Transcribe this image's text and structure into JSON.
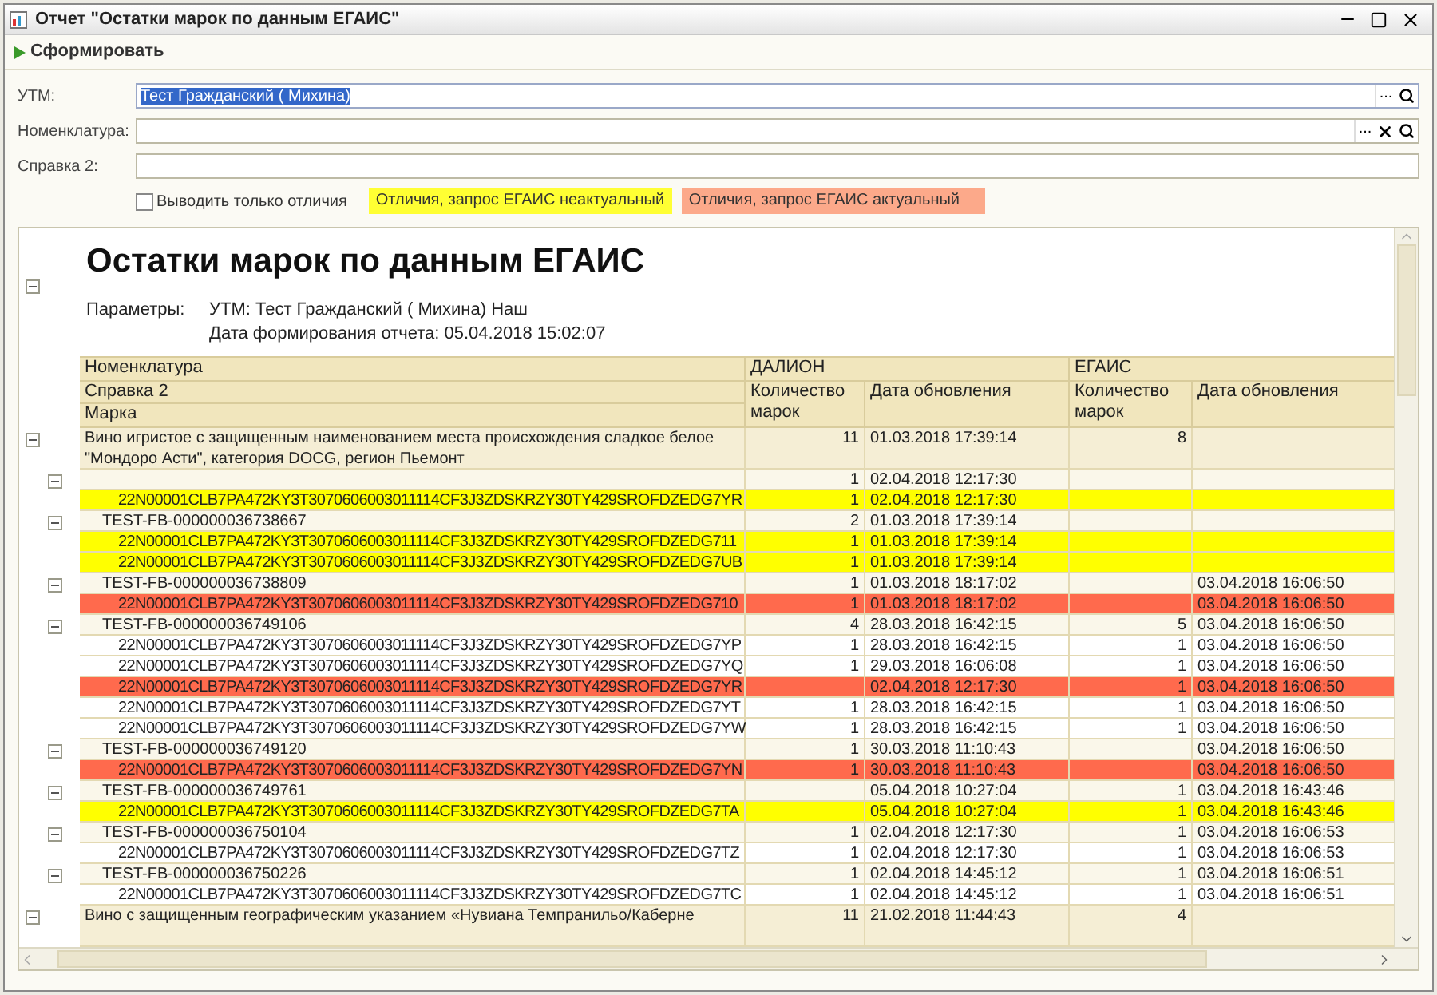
{
  "window": {
    "title": "Отчет \"Остатки марок по данным ЕГАИС\""
  },
  "toolbar": {
    "generate_button": "Сформировать"
  },
  "form": {
    "fields": [
      {
        "label": "УТМ:",
        "value": "Тест Гражданский ( Михина)",
        "selected": true,
        "clear": false,
        "buttons": true
      },
      {
        "label": "Номенклатура:",
        "selected": false,
        "clear": true,
        "buttons": true
      },
      {
        "label": "Справка 2:",
        "selected": false,
        "clear": false,
        "buttons": false
      }
    ],
    "select_button": "...",
    "only_diff": {
      "label": "Выводить только отличия",
      "checked": false
    },
    "legend": [
      {
        "label": "Отличия, запрос ЕГАИС неактуальный",
        "color": "#ffff33"
      },
      {
        "label": "Отличия, запрос ЕГАИС актуальный",
        "color": "#fca98a"
      }
    ]
  },
  "report": {
    "title": "Остатки марок по данным ЕГАИС",
    "expanded": true,
    "params_label": "Параметры:",
    "params": [
      "УТМ: Тест Гражданский ( Михина) Наш",
      "Дата формирования отчета: 05.04.2018 15:02:07"
    ],
    "header": {
      "name_rows": [
        "Номенклатура",
        "Справка 2",
        "Марка"
      ],
      "groups": [
        {
          "label": "ДАЛИОН",
          "qty": "Количество марок",
          "date": "Дата обновления"
        },
        {
          "label": "ЕГАИС",
          "qty": "Количество марок",
          "date": "Дата обновления"
        }
      ]
    },
    "products": [
      {
        "name": "Вино игристое с защищенным наименованием места происхождения сладкое белое \"Мондоро Асти\", категория DOCG, регион Пьемонт",
        "qty1": "11",
        "date1": "01.03.2018 17:39:14",
        "qty2": "8",
        "expanded": true,
        "children": [
          {
            "qty1": "1",
            "date1": "02.04.2018 12:17:30",
            "expanded": true,
            "children": [
              {
                "name": "22N00001CLB7PA472KY3T3070606003011114CF3J3ZDSKRZY30TY429SROFDZEDG7YR",
                "color": "#ffff00",
                "qty1": "1",
                "date1": "02.04.2018 12:17:30"
              }
            ]
          },
          {
            "name": "TEST-FB-000000036738667",
            "qty1": "2",
            "date1": "01.03.2018 17:39:14",
            "expanded": true,
            "children": [
              {
                "name": "22N00001CLB7PA472KY3T3070606003011114CF3J3ZDSKRZY30TY429SROFDZEDG711",
                "color": "#ffff00",
                "qty1": "1",
                "date1": "01.03.2018 17:39:14"
              },
              {
                "name": "22N00001CLB7PA472KY3T3070606003011114CF3J3ZDSKRZY30TY429SROFDZEDG7UB",
                "color": "#ffff00",
                "qty1": "1",
                "date1": "01.03.2018 17:39:14"
              }
            ]
          },
          {
            "name": "TEST-FB-000000036738809",
            "qty1": "1",
            "date1": "01.03.2018 18:17:02",
            "date2": "03.04.2018 16:06:50",
            "expanded": true,
            "children": [
              {
                "name": "22N00001CLB7PA472KY3T3070606003011114CF3J3ZDSKRZY30TY429SROFDZEDG710",
                "color": "#ff6a4d",
                "qty1": "1",
                "date1": "01.03.2018 18:17:02",
                "date2": "03.04.2018 16:06:50"
              }
            ]
          },
          {
            "name": "TEST-FB-000000036749106",
            "qty1": "4",
            "date1": "28.03.2018 16:42:15",
            "qty2": "5",
            "date2": "03.04.2018 16:06:50",
            "expanded": true,
            "children": [
              {
                "name": "22N00001CLB7PA472KY3T3070606003011114CF3J3ZDSKRZY30TY429SROFDZEDG7YP",
                "qty1": "1",
                "date1": "28.03.2018 16:42:15",
                "qty2": "1",
                "date2": "03.04.2018 16:06:50"
              },
              {
                "name": "22N00001CLB7PA472KY3T3070606003011114CF3J3ZDSKRZY30TY429SROFDZEDG7YQ",
                "qty1": "1",
                "date1": "29.03.2018 16:06:08",
                "qty2": "1",
                "date2": "03.04.2018 16:06:50"
              },
              {
                "name": "22N00001CLB7PA472KY3T3070606003011114CF3J3ZDSKRZY30TY429SROFDZEDG7YR",
                "color": "#ff6a4d",
                "date1": "02.04.2018 12:17:30",
                "qty2": "1",
                "date2": "03.04.2018 16:06:50"
              },
              {
                "name": "22N00001CLB7PA472KY3T3070606003011114CF3J3ZDSKRZY30TY429SROFDZEDG7YT",
                "qty1": "1",
                "date1": "28.03.2018 16:42:15",
                "qty2": "1",
                "date2": "03.04.2018 16:06:50"
              },
              {
                "name": "22N00001CLB7PA472KY3T3070606003011114CF3J3ZDSKRZY30TY429SROFDZEDG7YW",
                "qty1": "1",
                "date1": "28.03.2018 16:42:15",
                "qty2": "1",
                "date2": "03.04.2018 16:06:50"
              }
            ]
          },
          {
            "name": "TEST-FB-000000036749120",
            "qty1": "1",
            "date1": "30.03.2018 11:10:43",
            "date2": "03.04.2018 16:06:50",
            "expanded": true,
            "children": [
              {
                "name": "22N00001CLB7PA472KY3T3070606003011114CF3J3ZDSKRZY30TY429SROFDZEDG7YN",
                "color": "#ff6a4d",
                "qty1": "1",
                "date1": "30.03.2018 11:10:43",
                "date2": "03.04.2018 16:06:50"
              }
            ]
          },
          {
            "name": "TEST-FB-000000036749761",
            "date1": "05.04.2018 10:27:04",
            "qty2": "1",
            "date2": "03.04.2018 16:43:46",
            "expanded": true,
            "children": [
              {
                "name": "22N00001CLB7PA472KY3T3070606003011114CF3J3ZDSKRZY30TY429SROFDZEDG7TA",
                "color": "#ffff00",
                "date1": "05.04.2018 10:27:04",
                "qty2": "1",
                "date2": "03.04.2018 16:43:46"
              }
            ]
          },
          {
            "name": "TEST-FB-000000036750104",
            "qty1": "1",
            "date1": "02.04.2018 12:17:30",
            "qty2": "1",
            "date2": "03.04.2018 16:06:53",
            "expanded": true,
            "children": [
              {
                "name": "22N00001CLB7PA472KY3T3070606003011114CF3J3ZDSKRZY30TY429SROFDZEDG7TZ",
                "qty1": "1",
                "date1": "02.04.2018 12:17:30",
                "qty2": "1",
                "date2": "03.04.2018 16:06:53"
              }
            ]
          },
          {
            "name": "TEST-FB-000000036750226",
            "qty1": "1",
            "date1": "02.04.2018 14:45:12",
            "qty2": "1",
            "date2": "03.04.2018 16:06:51",
            "expanded": true,
            "children": [
              {
                "name": "22N00001CLB7PA472KY3T3070606003011114CF3J3ZDSKRZY30TY429SROFDZEDG7TC",
                "qty1": "1",
                "date1": "02.04.2018 14:45:12",
                "qty2": "1",
                "date2": "03.04.2018 16:06:51"
              }
            ]
          }
        ]
      },
      {
        "name": "Вино с защищенным географическим указанием «Нувиана Темпранильо/Каберне",
        "qty1": "11",
        "date1": "21.02.2018 11:44:43",
        "qty2": "4",
        "expanded": true
      }
    ]
  }
}
